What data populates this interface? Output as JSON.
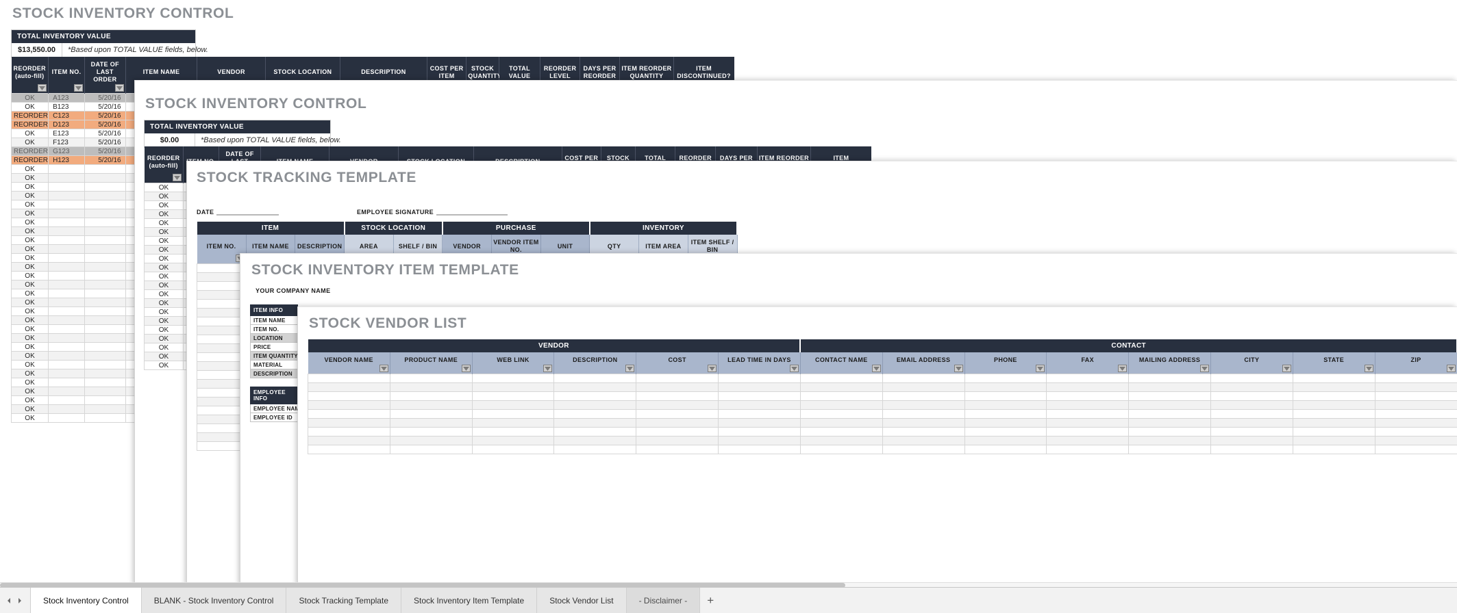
{
  "windows": {
    "stock_inventory_control": {
      "title": "STOCK INVENTORY CONTROL",
      "total_box": {
        "header": "TOTAL INVENTORY VALUE",
        "amount": "$13,550.00",
        "note": "*Based upon TOTAL VALUE fields, below."
      },
      "columns": [
        "REORDER (auto-fill)",
        "ITEM NO.",
        "DATE OF LAST ORDER",
        "ITEM NAME",
        "VENDOR",
        "STOCK LOCATION",
        "DESCRIPTION",
        "COST PER ITEM",
        "STOCK QUANTITY",
        "TOTAL VALUE",
        "REORDER LEVEL",
        "DAYS PER REORDER",
        "ITEM REORDER QUANTITY",
        "ITEM DISCONTINUED?"
      ],
      "rows": [
        {
          "reorder": "OK",
          "item_no": "A123",
          "date": "5/20/16",
          "state": "selected"
        },
        {
          "reorder": "OK",
          "item_no": "B123",
          "date": "5/20/16",
          "state": "normal"
        },
        {
          "reorder": "REORDER",
          "item_no": "C123",
          "date": "5/20/16",
          "state": "reorder"
        },
        {
          "reorder": "REORDER",
          "item_no": "D123",
          "date": "5/20/16",
          "state": "reorder"
        },
        {
          "reorder": "OK",
          "item_no": "E123",
          "date": "5/20/16",
          "state": "normal"
        },
        {
          "reorder": "OK",
          "item_no": "F123",
          "date": "5/20/16",
          "state": "alt"
        },
        {
          "reorder": "REORDER",
          "item_no": "G123",
          "date": "5/20/16",
          "state": "selected"
        },
        {
          "reorder": "REORDER",
          "item_no": "H123",
          "date": "5/20/16",
          "state": "reorder"
        },
        {
          "reorder": "OK",
          "item_no": "",
          "date": "",
          "state": "normal"
        },
        {
          "reorder": "OK",
          "item_no": "",
          "date": "",
          "state": "alt"
        },
        {
          "reorder": "OK",
          "item_no": "",
          "date": "",
          "state": "normal"
        },
        {
          "reorder": "OK",
          "item_no": "",
          "date": "",
          "state": "alt"
        },
        {
          "reorder": "OK",
          "item_no": "",
          "date": "",
          "state": "normal"
        },
        {
          "reorder": "OK",
          "item_no": "",
          "date": "",
          "state": "alt"
        },
        {
          "reorder": "OK",
          "item_no": "",
          "date": "",
          "state": "normal"
        },
        {
          "reorder": "OK",
          "item_no": "",
          "date": "",
          "state": "alt"
        },
        {
          "reorder": "OK",
          "item_no": "",
          "date": "",
          "state": "normal"
        },
        {
          "reorder": "OK",
          "item_no": "",
          "date": "",
          "state": "alt"
        },
        {
          "reorder": "OK",
          "item_no": "",
          "date": "",
          "state": "normal"
        },
        {
          "reorder": "OK",
          "item_no": "",
          "date": "",
          "state": "alt"
        },
        {
          "reorder": "OK",
          "item_no": "",
          "date": "",
          "state": "normal"
        },
        {
          "reorder": "OK",
          "item_no": "",
          "date": "",
          "state": "alt"
        },
        {
          "reorder": "OK",
          "item_no": "",
          "date": "",
          "state": "normal"
        },
        {
          "reorder": "OK",
          "item_no": "",
          "date": "",
          "state": "alt"
        },
        {
          "reorder": "OK",
          "item_no": "",
          "date": "",
          "state": "normal"
        },
        {
          "reorder": "OK",
          "item_no": "",
          "date": "",
          "state": "alt"
        },
        {
          "reorder": "OK",
          "item_no": "",
          "date": "",
          "state": "normal"
        },
        {
          "reorder": "OK",
          "item_no": "",
          "date": "",
          "state": "alt"
        },
        {
          "reorder": "OK",
          "item_no": "",
          "date": "",
          "state": "normal"
        },
        {
          "reorder": "OK",
          "item_no": "",
          "date": "",
          "state": "alt"
        },
        {
          "reorder": "OK",
          "item_no": "",
          "date": "",
          "state": "normal"
        },
        {
          "reorder": "OK",
          "item_no": "",
          "date": "",
          "state": "alt"
        },
        {
          "reorder": "OK",
          "item_no": "",
          "date": "",
          "state": "normal"
        },
        {
          "reorder": "OK",
          "item_no": "",
          "date": "",
          "state": "alt"
        },
        {
          "reorder": "OK",
          "item_no": "",
          "date": "",
          "state": "normal"
        },
        {
          "reorder": "OK",
          "item_no": "",
          "date": "",
          "state": "alt"
        },
        {
          "reorder": "OK",
          "item_no": "",
          "date": "",
          "state": "normal"
        }
      ]
    },
    "blank_stock_inventory_control": {
      "title": "STOCK INVENTORY CONTROL",
      "total_box": {
        "header": "TOTAL INVENTORY VALUE",
        "amount": "$0.00",
        "note": "*Based upon TOTAL VALUE fields, below."
      },
      "columns": [
        "REORDER (auto-fill)",
        "ITEM NO.",
        "DATE OF LAST ORDER",
        "ITEM NAME",
        "VENDOR",
        "STOCK LOCATION",
        "DESCRIPTION",
        "COST PER ITEM",
        "STOCK QUANTITY",
        "TOTAL VALUE",
        "REORDER LEVEL",
        "DAYS PER REORDER",
        "ITEM REORDER QUANTITY",
        "ITEM DISCONTINUED?"
      ],
      "reorder_value": "OK",
      "row_count": 21
    },
    "stock_tracking_template": {
      "title": "STOCK TRACKING TEMPLATE",
      "fields": [
        {
          "label": "DATE",
          "value": ""
        },
        {
          "label": "EMPLOYEE SIGNATURE",
          "value": ""
        }
      ],
      "groups": [
        "ITEM",
        "STOCK LOCATION",
        "PURCHASE",
        "INVENTORY"
      ],
      "columns": [
        "ITEM NO.",
        "ITEM NAME",
        "DESCRIPTION",
        "AREA",
        "SHELF / BIN",
        "VENDOR",
        "VENDOR ITEM NO.",
        "UNIT",
        "QTY",
        "ITEM AREA",
        "ITEM SHELF / BIN"
      ],
      "row_count": 21
    },
    "stock_inventory_item_template": {
      "title": "STOCK INVENTORY ITEM TEMPLATE",
      "company_name": "YOUR COMPANY NAME",
      "item_info": {
        "header": "ITEM INFO",
        "rows": [
          "ITEM NAME",
          "ITEM NO.",
          "LOCATION",
          "PRICE",
          "ITEM QUANTITY",
          "MATERIAL",
          "DESCRIPTION"
        ]
      },
      "employee_info": {
        "header": "EMPLOYEE INFO",
        "rows": [
          "EMPLOYEE NAME",
          "EMPLOYEE ID"
        ]
      }
    },
    "stock_vendor_list": {
      "title": "STOCK VENDOR LIST",
      "groups": [
        "VENDOR",
        "CONTACT"
      ],
      "columns": [
        "VENDOR NAME",
        "PRODUCT NAME",
        "WEB LINK",
        "DESCRIPTION",
        "COST",
        "LEAD TIME IN DAYS",
        "CONTACT NAME",
        "EMAIL ADDRESS",
        "PHONE",
        "FAX",
        "MAILING ADDRESS",
        "CITY",
        "STATE",
        "ZIP"
      ],
      "row_count": 9
    }
  },
  "sheet_tabs": {
    "items": [
      {
        "label": "Stock Inventory Control",
        "state": "active"
      },
      {
        "label": "BLANK - Stock Inventory Control",
        "state": "inactive"
      },
      {
        "label": "Stock Tracking Template",
        "state": "inactive"
      },
      {
        "label": "Stock Inventory Item Template",
        "state": "inactive"
      },
      {
        "label": "Stock Vendor List",
        "state": "inactive"
      },
      {
        "label": "- Disclaimer -",
        "state": "ghost"
      }
    ],
    "add_label": "+",
    "nav": {
      "prev": "◀",
      "next": "▶"
    }
  },
  "colors": {
    "header_dark": "#28303f",
    "reorder_orange": "#f2ab7e",
    "selected_gray": "#bdbdbd",
    "group_blue": "#a9b6cc",
    "group_blue_light": "#ccd4e1",
    "title_gray": "#8b8f94"
  }
}
